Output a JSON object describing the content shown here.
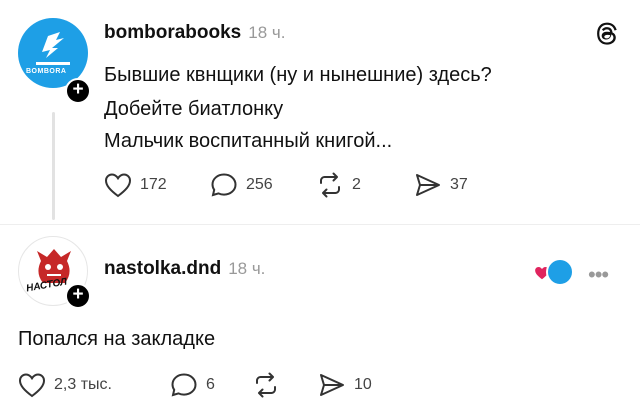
{
  "post1": {
    "username": "bomborabooks",
    "time": "18 ч.",
    "avatar_text": "BOMBORA",
    "lines": [
      "Бывшие квнщики (ну и нынешние) здесь?",
      "Добейте биатлонку",
      "Мальчик воспитанный книгой..."
    ],
    "actions": {
      "likes": "172",
      "comments": "256",
      "reposts": "2",
      "shares": "37"
    }
  },
  "post2": {
    "username": "nastolka.dnd",
    "time": "18 ч.",
    "avatar_text": "НАСТОЛ",
    "text": "Попался на закладке",
    "actions": {
      "likes": "2,3 тыс.",
      "comments": "6",
      "reposts": "",
      "shares": "10"
    }
  },
  "icons": {
    "threads": "threads-logo-icon",
    "like": "heart-icon",
    "comment": "comment-bubble-icon",
    "repost": "repost-icon",
    "share": "send-icon",
    "more": "more-dots-icon",
    "follow": "plus-icon"
  },
  "colors": {
    "accent_blue": "#1e9fe6",
    "like_red": "#e0245e",
    "line_gray": "#e2e2e2"
  }
}
